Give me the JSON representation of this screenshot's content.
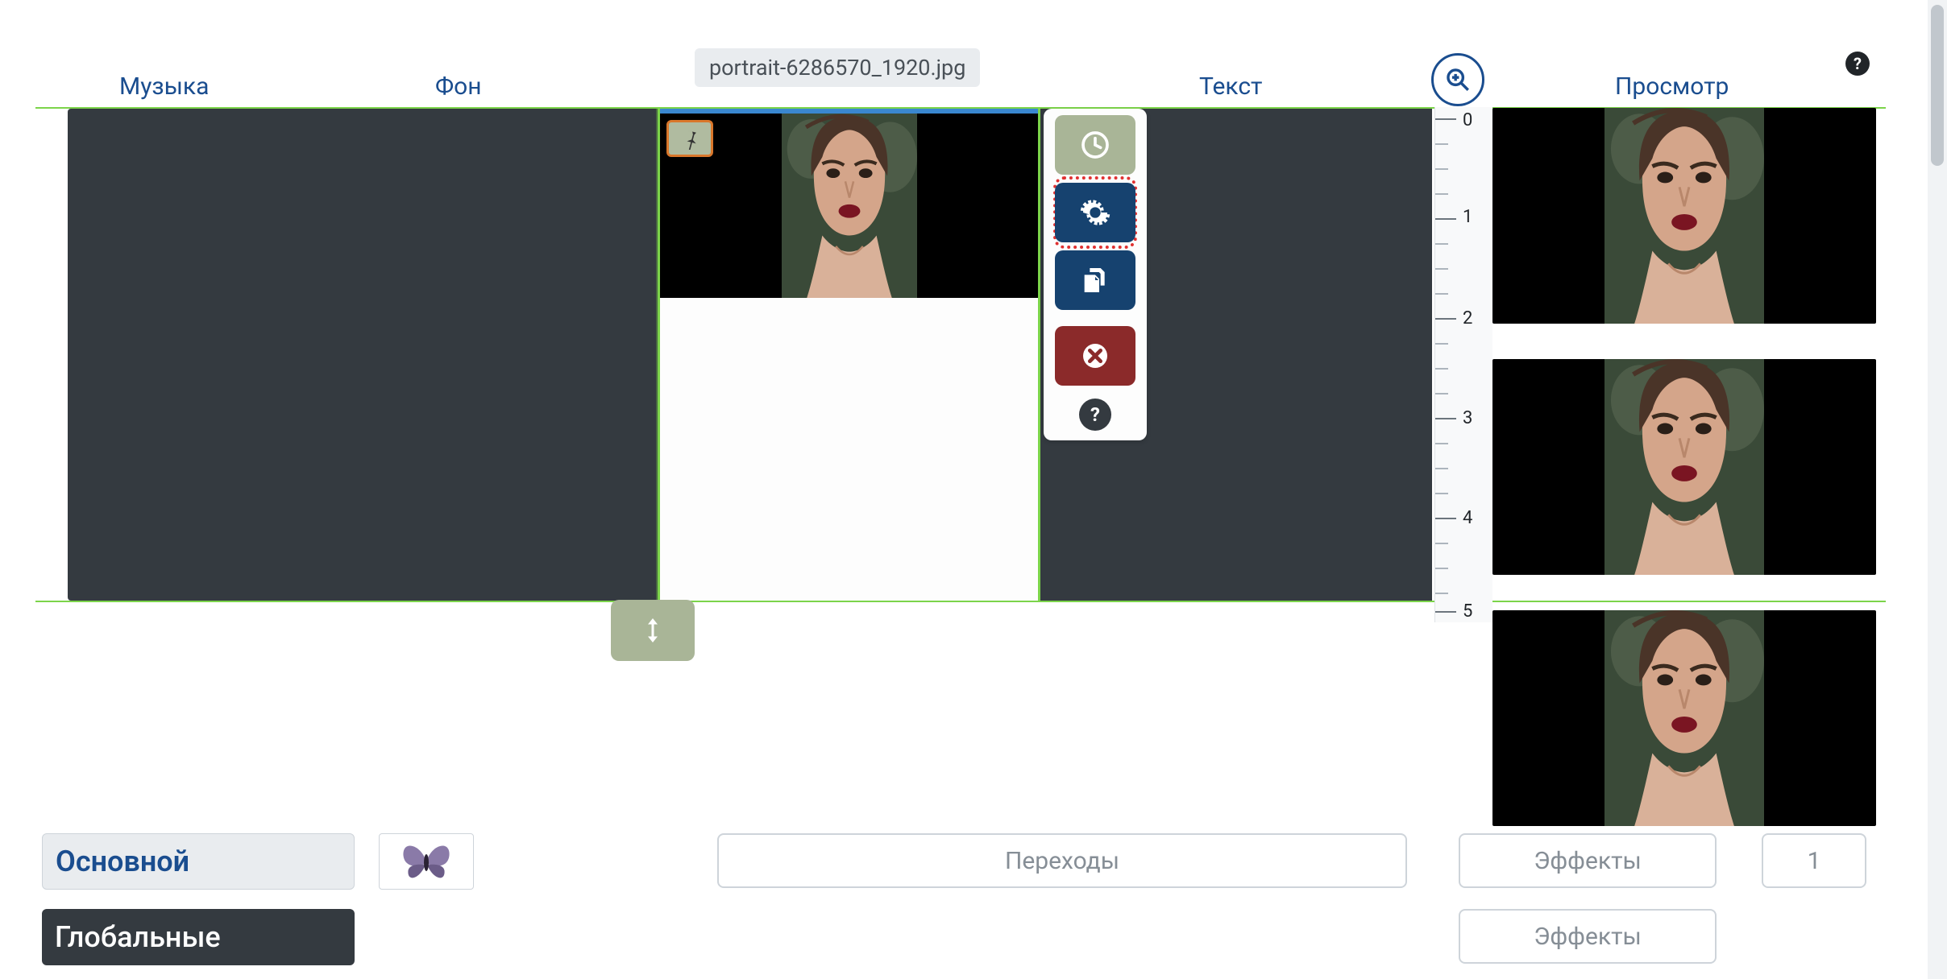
{
  "header": {
    "music": "Музыка",
    "background": "Фон",
    "text": "Текст",
    "preview": "Просмотр",
    "filename": "portrait-6286570_1920.jpg"
  },
  "ruler": {
    "ticks": [
      "0",
      "1",
      "2",
      "3",
      "4",
      "5"
    ]
  },
  "bottom": {
    "tab_main": "Основной",
    "tab_global": "Глобальные",
    "transitions": "Переходы",
    "effects": "Эффекты",
    "page": "1"
  },
  "tools": {
    "clock": "timing",
    "gear": "settings",
    "copy": "duplicate",
    "delete": "delete",
    "help": "?"
  }
}
